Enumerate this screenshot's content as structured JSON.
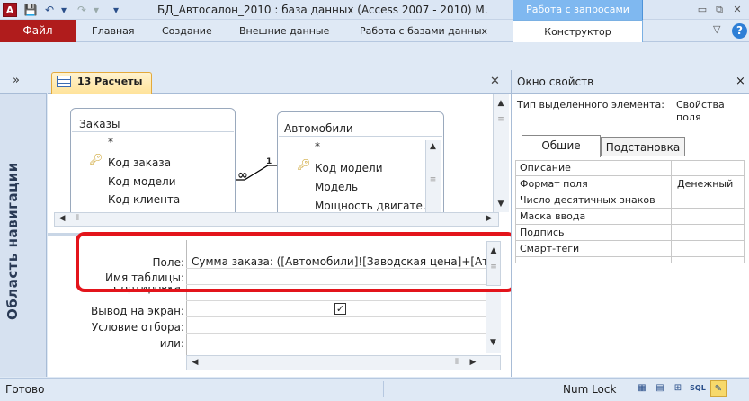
{
  "window": {
    "app_icon": "A",
    "title": "БД_Автосалон_2010 : база данных (Access 2007 - 2010) М.",
    "context_tab_header": "Работа с запросами",
    "quick_access": {
      "save_icon": "💾",
      "undo_icon": "↶",
      "redo_icon": "↷",
      "customize_icon": "▾"
    },
    "controls": {
      "minimize": "▭",
      "restore": "⧉",
      "close": "✕"
    }
  },
  "ribbon": {
    "tabs": [
      {
        "label": "Файл"
      },
      {
        "label": "Главная"
      },
      {
        "label": "Создание"
      },
      {
        "label": "Внешние данные"
      },
      {
        "label": "Работа с базами данных"
      },
      {
        "label": "Конструктор"
      }
    ],
    "help_icon": "?",
    "minimize_ribbon_icon": "▽"
  },
  "nav_pane": {
    "label": "Область навигации",
    "chevron": "»"
  },
  "document": {
    "tab_label": "13 Расчеты",
    "close_icon": "✕",
    "tables": [
      {
        "title": "Заказы",
        "fields": [
          "*",
          "Код заказа",
          "Код модели",
          "Код клиента"
        ]
      },
      {
        "title": "Автомобили",
        "fields": [
          "*",
          "Код модели",
          "Модель",
          "Мощность двигате."
        ]
      }
    ],
    "relationship": {
      "left": "∞",
      "right": "1"
    },
    "grid_labels": [
      "Поле:",
      "Имя таблицы:",
      "Сортировка:",
      "Вывод на экран:",
      "Условие отбора:",
      "или:"
    ],
    "field_value": "Сумма заказа: ([Автомобили]![Заводская цена]+[Ат",
    "show_checked": "✓"
  },
  "props": {
    "title": "Окно свойств",
    "close_icon": "×",
    "selection_type_label": "Тип выделенного элемента:",
    "selection_type_value": "Свойства поля",
    "tabs": [
      "Общие",
      "Подстановка"
    ],
    "rows": [
      {
        "name": "Описание",
        "value": ""
      },
      {
        "name": "Формат поля",
        "value": "Денежный"
      },
      {
        "name": "Число десятичных знаков",
        "value": ""
      },
      {
        "name": "Маска ввода",
        "value": ""
      },
      {
        "name": "Подпись",
        "value": ""
      },
      {
        "name": "Смарт-теги",
        "value": ""
      }
    ]
  },
  "status": {
    "ready": "Готово",
    "num_lock": "Num Lock",
    "views": [
      "▦",
      "▤",
      "⊞",
      "SQL",
      "✎"
    ]
  },
  "accent": {
    "file_tab": "#b01c1c",
    "highlight": "#e3141b",
    "context": "#7fb8f0"
  }
}
